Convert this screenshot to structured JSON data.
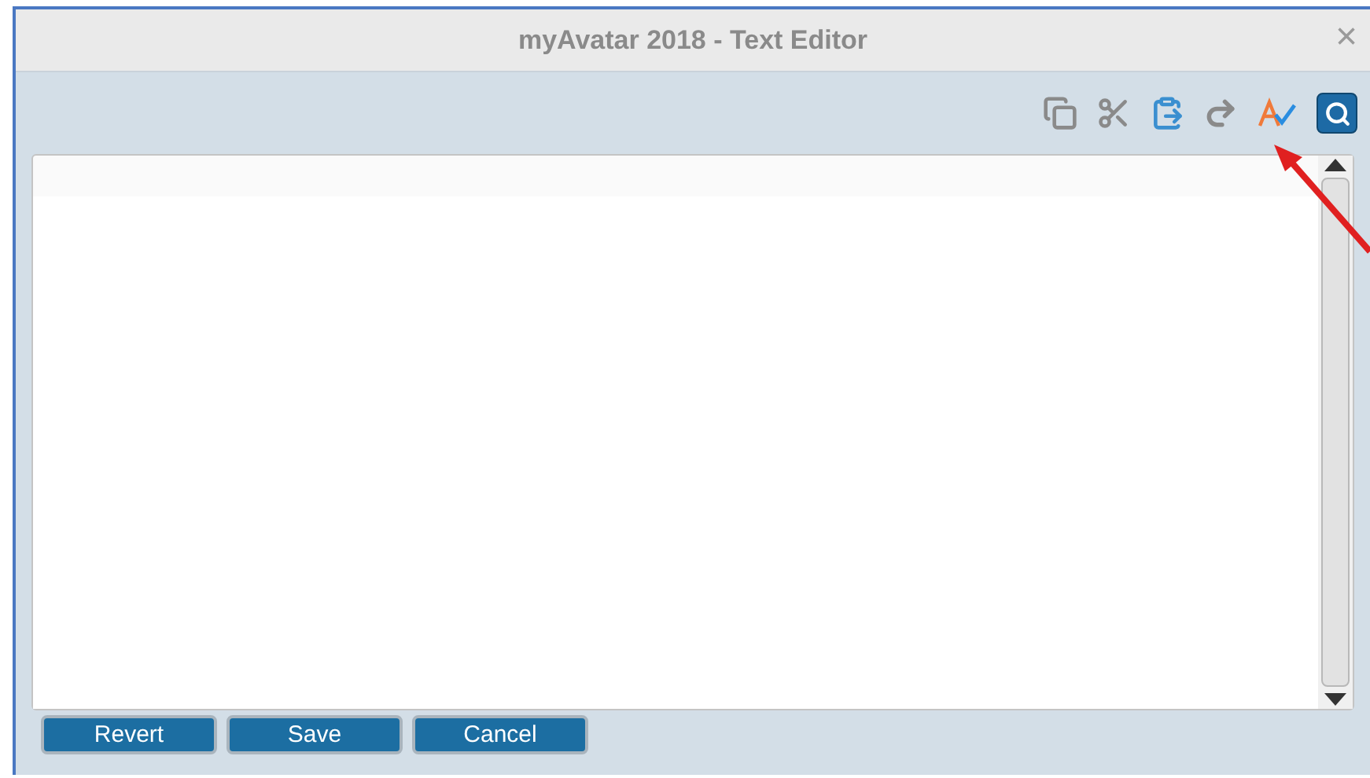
{
  "window": {
    "title": "myAvatar 2018 - Text Editor",
    "close": "×"
  },
  "buttons": [
    "Revert",
    "Save",
    "Cancel"
  ]
}
